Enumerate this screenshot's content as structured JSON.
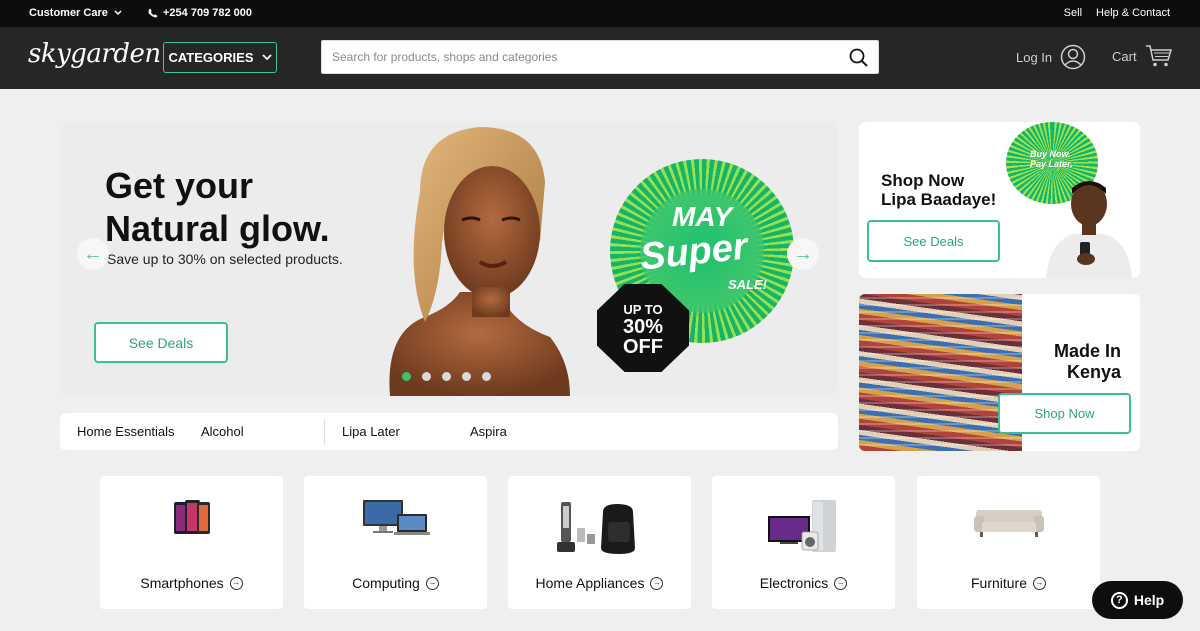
{
  "topbar": {
    "customer_care": "Customer Care",
    "phone": "+254 709 782 000",
    "sell": "Sell",
    "help_contact": "Help & Contact"
  },
  "header": {
    "logo": "skygarden",
    "categories_label": "CATEGORIES",
    "search_placeholder": "Search for products, shops and categories",
    "login_label": "Log In",
    "cart_label": "Cart"
  },
  "hero": {
    "title_line1": "Get your",
    "title_line2": "Natural glow.",
    "subtitle": "Save up to 30% on selected products.",
    "button": "See Deals",
    "promo_may": "MAY",
    "promo_super": "Super",
    "promo_sale": "SALE!",
    "promo_upto": "UP TO",
    "promo_percent": "30%",
    "promo_off": "OFF",
    "slides": 5,
    "active_slide": 1
  },
  "side_banner_1": {
    "title_line1": "Shop Now",
    "title_line2": "Lipa Baadaye!",
    "badge_line1": "Buy Now.",
    "badge_line2": "Pay Later.",
    "button": "See Deals"
  },
  "side_banner_2": {
    "title_line1": "Made In",
    "title_line2": "Kenya",
    "button": "Shop Now"
  },
  "quick_links": [
    "Home Essentials",
    "Alcohol",
    "Lipa Later",
    "Aspira"
  ],
  "categories": [
    {
      "label": "Smartphones",
      "icon": "smartphones-icon"
    },
    {
      "label": "Computing",
      "icon": "computing-icon"
    },
    {
      "label": "Home Appliances",
      "icon": "home-appliances-icon"
    },
    {
      "label": "Electronics",
      "icon": "electronics-icon"
    },
    {
      "label": "Furniture",
      "icon": "furniture-icon"
    }
  ],
  "help_button": "Help",
  "colors": {
    "accent": "#3dbf93",
    "header_bg": "#262626",
    "topbar_bg": "#0d0d0d"
  }
}
